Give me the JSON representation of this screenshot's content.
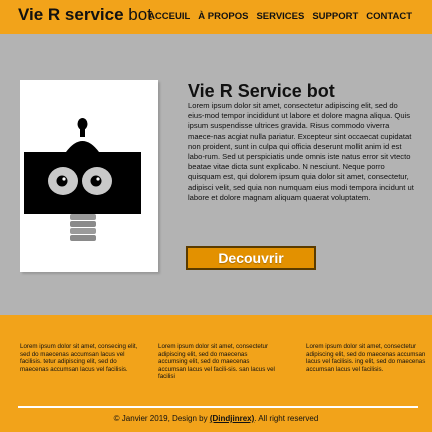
{
  "header": {
    "brand_bold": "Vie R service",
    "brand_rest": " bot",
    "nav": [
      "ACCEUIL",
      "À PROPOS",
      "SERVICES",
      "SUPPORT",
      "CONTACT"
    ]
  },
  "hero": {
    "image_icon": "robot-icon",
    "title": "Vie R Service bot",
    "text": "Lorem ipsum dolor sit amet, consectetur adipiscing elit, sed do eius-mod tempor incididunt ut labore et dolore magna aliqua. Quis ipsum suspendisse ultrices gravida. Risus commodo viverra maece-nas acgiat nulla pariatur. Excepteur sint occaecat cupidatat non proident, sunt in culpa qui officia deserunt mollit anim id est labo-rum. Sed ut perspiciatis unde omnis iste natus error sit vtecto beatae vitae dicta sunt explicabo. N nesciunt. Neque porro quisquam est, qui dolorem ipsum quia dolor sit amet, consectetur, adipisci velit, sed quia non numquam eius modi tempora incidunt ut labore et dolore magnam aliquam quaerat voluptatem.",
    "cta_label": "Decouvrir"
  },
  "footer": {
    "columns": [
      "Lorem ipsum dolor sit amet, consecing elit, sed do maecenas accumsan lacus vel facilisis. tetur adipiscing elit, sed do maecenas accumsan lacus vel facilisis.",
      "Lorem ipsum dolor sit amet, consectetur adipiscing elit, sed do maecenas accumsing elit, sed do maecenas accumsan lacus vel facili-sis. san lacus vel facilisi",
      "Lorem ipsum dolor sit amet, consectetur adipiscing elit, sed do maecenas accumsan lacus vel facilisis. ing elit, sed do maecenas accumsan lacus vel facilisis."
    ],
    "copyright_prefix": "© Janvier 2019, Design by ",
    "copyright_author": "(Dindjinrex)",
    "copyright_suffix": ". All right reserved"
  },
  "colors": {
    "accent": "#f2a31a",
    "hero_bg": "#b3b3b3",
    "button_bg": "#e39100",
    "button_border": "#5a3b00"
  }
}
